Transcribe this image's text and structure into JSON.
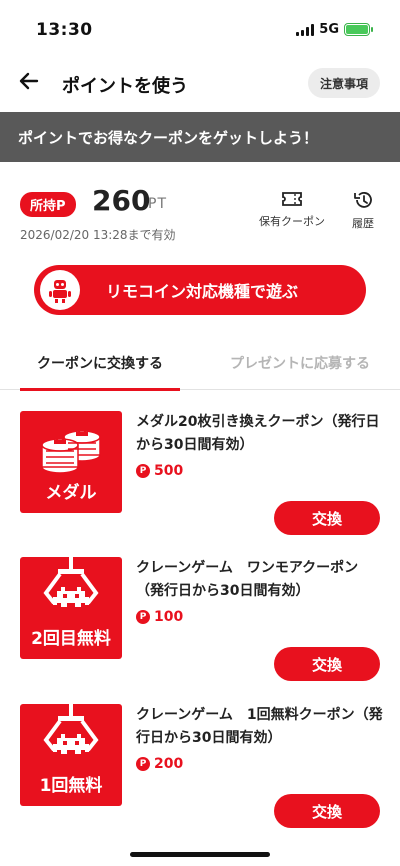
{
  "status": {
    "time": "13:30",
    "network": "5G",
    "battery": 1.0
  },
  "nav": {
    "title": "ポイントを使う",
    "notice_label": "注意事項"
  },
  "banner": {
    "text": "ポイントでお得なクーポンをゲットしよう！"
  },
  "points": {
    "badge": "所持P",
    "value": "260",
    "unit": "PT",
    "expiry": "2026/02/20 13:28まで有効",
    "coupon_link_label": "保有クーポン",
    "history_link_label": "履歴"
  },
  "play_button": {
    "label": "リモコイン対応機種で遊ぶ"
  },
  "tabs": [
    {
      "label": "クーポンに交換する",
      "active": true
    },
    {
      "label": "プレゼントに応募する",
      "active": false
    }
  ],
  "coupons": [
    {
      "image_caption": "メダル",
      "title": "メダル20枚引き換えクーポン（発行日から30日間有効）",
      "price_mark": "P",
      "price": "500",
      "button": "交換"
    },
    {
      "image_caption": "2回目無料",
      "title": "クレーンゲーム　ワンモアクーポン（発行日から30日間有効）",
      "price_mark": "P",
      "price": "100",
      "button": "交換"
    },
    {
      "image_caption": "1回無料",
      "title": "クレーンゲーム　1回無料クーポン（発行日から30日間有効）",
      "price_mark": "P",
      "price": "200",
      "button": "交換"
    }
  ],
  "colors": {
    "accent": "#e8111e",
    "banner_bg": "#595959",
    "muted_tab": "#b5b5b5"
  },
  "icons": [
    "back-arrow-icon",
    "ticket-icon",
    "history-icon",
    "robot-icon",
    "coin-stack-icon",
    "crane-invader-icon",
    "point-icon"
  ]
}
